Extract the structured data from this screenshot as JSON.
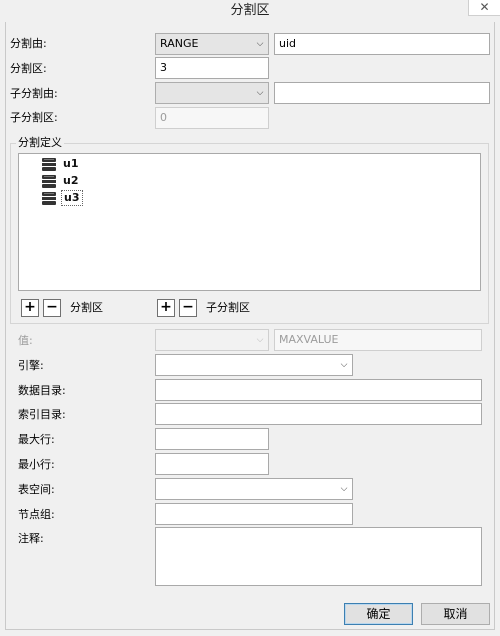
{
  "window": {
    "title": "分割区",
    "close_label": "✕"
  },
  "form": {
    "partition_by": {
      "label": "分割由:",
      "selected": "RANGE",
      "expression": "uid"
    },
    "partitions": {
      "label": "分割区:",
      "value": "3"
    },
    "subpartition_by": {
      "label": "子分割由:",
      "selected": "",
      "expression": ""
    },
    "subpartitions": {
      "label": "子分割区:",
      "value": "0"
    }
  },
  "definition": {
    "title": "分割定义",
    "items": [
      {
        "label": "u1"
      },
      {
        "label": "u2"
      },
      {
        "label": "u3"
      }
    ],
    "partition_buttons_label": "分割区",
    "subpartition_buttons_label": "子分割区",
    "add_glyph": "+",
    "remove_glyph": "−"
  },
  "details": {
    "value": {
      "label": "值:",
      "operator": "",
      "text": "MAXVALUE"
    },
    "engine": {
      "label": "引擎:",
      "selected": ""
    },
    "data_directory": {
      "label": "数据目录:",
      "value": ""
    },
    "index_directory": {
      "label": "索引目录:",
      "value": ""
    },
    "max_rows": {
      "label": "最大行:",
      "value": ""
    },
    "min_rows": {
      "label": "最小行:",
      "value": ""
    },
    "tablespace": {
      "label": "表空间:",
      "selected": ""
    },
    "node_group": {
      "label": "节点组:",
      "value": ""
    },
    "comment": {
      "label": "注释:",
      "value": ""
    }
  },
  "footer": {
    "ok_label": "确定",
    "cancel_label": "取消"
  },
  "icons": {
    "dropdown": "chevron-down-icon",
    "tree_item": "database-icon"
  },
  "colors": {
    "window_bg": "#f0f0f0",
    "input_border": "#a9a9a9",
    "default_button_border": "#3c7fb1"
  }
}
